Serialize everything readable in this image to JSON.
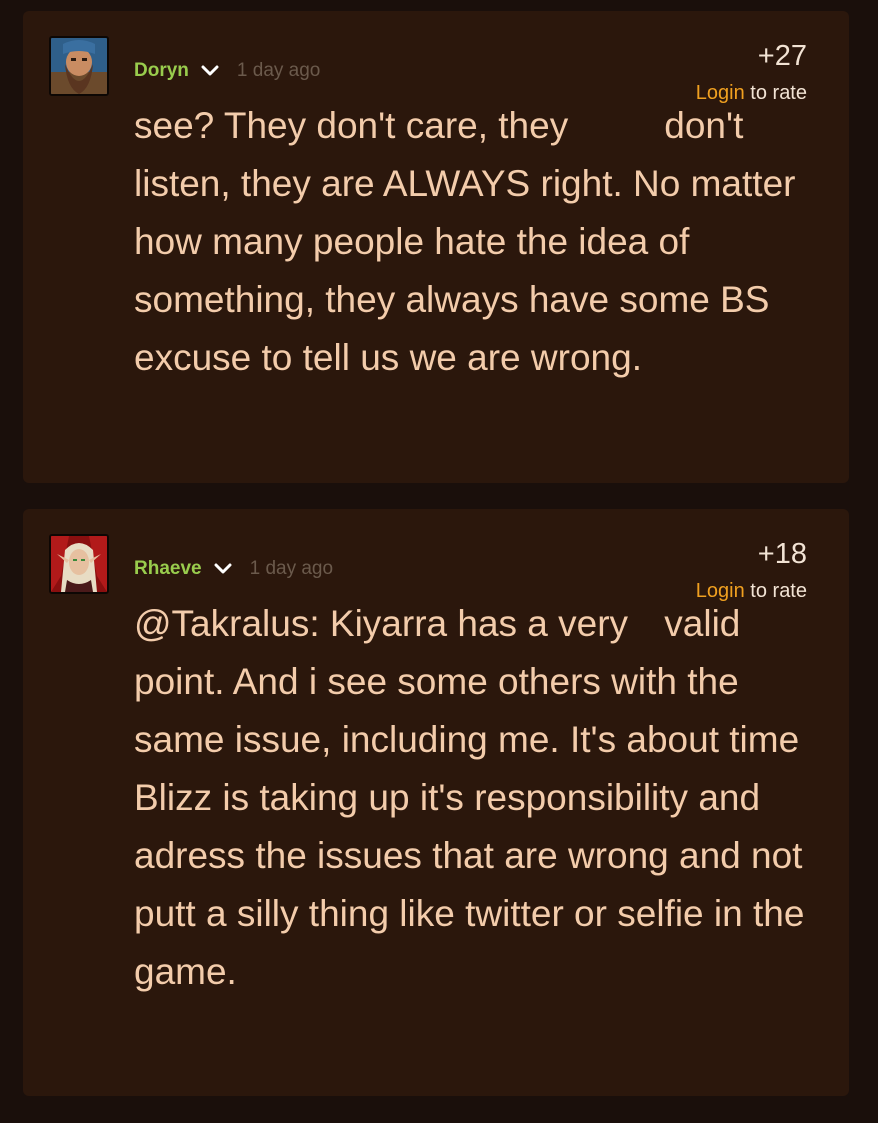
{
  "comments": [
    {
      "author": "Doryn",
      "time": "1 day ago",
      "score": "+27",
      "login_label": "Login",
      "rate_label": " to rate",
      "avatar_icon": "dwarf-portrait",
      "text_first": "see? They don't care, they",
      "text_rest": "don't listen, they are ALWAYS right. No matter how many people hate the idea of something, they always have some BS excuse to tell us we are wrong."
    },
    {
      "author": "Rhaeve",
      "time": "1 day ago",
      "score": "+18",
      "login_label": "Login",
      "rate_label": " to rate",
      "avatar_icon": "blood-elf-portrait",
      "text_first": "@Takralus: Kiyarra has a very",
      "text_rest": "valid point. And i see some others with the same issue, including me. It's about time Blizz is taking up it's responsibility and adress the issues that are wrong and not putt a silly thing like twitter or selfie in the game."
    }
  ],
  "colors": {
    "page_bg": "#1a0f0b",
    "card_bg": "#2b170c",
    "author": "#99cc4d",
    "body_text": "#f3ccab",
    "login_link": "#f0a020",
    "timestamp": "#6b5a4c"
  }
}
